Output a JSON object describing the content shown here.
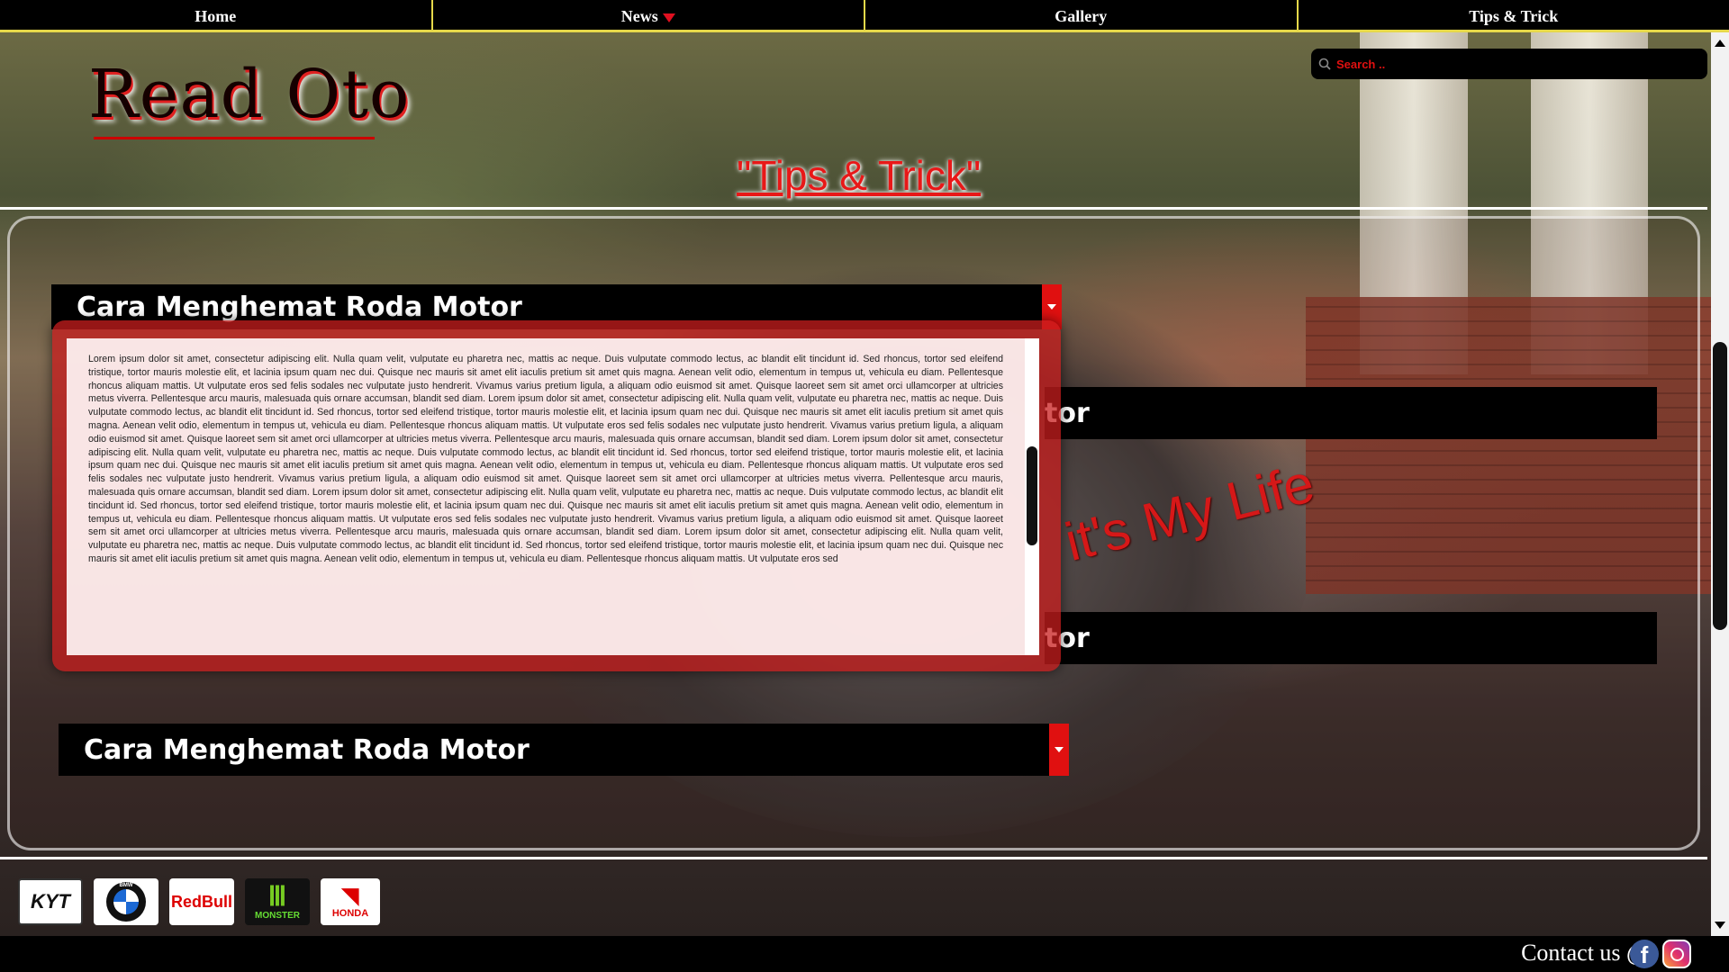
{
  "nav": {
    "items": [
      {
        "label": "Home"
      },
      {
        "label": "News"
      },
      {
        "label": "Gallery"
      },
      {
        "label": "Tips & Trick"
      }
    ]
  },
  "header": {
    "logo_text": "Read Oto",
    "page_heading": "\"Tips & Trick\"",
    "search_placeholder": "Search .."
  },
  "accordions": [
    {
      "title": "Cara Menghemat Roda Motor"
    },
    {
      "title": "tor"
    },
    {
      "title": "tor"
    },
    {
      "title": "Cara Menghemat Roda Motor"
    }
  ],
  "content": {
    "text": "Lorem ipsum dolor sit amet, consectetur adipiscing elit. Nulla quam velit, vulputate eu pharetra nec, mattis ac neque. Duis vulputate commodo lectus, ac blandit elit tincidunt id. Sed rhoncus, tortor sed eleifend tristique, tortor mauris molestie elit, et lacinia ipsum quam nec dui. Quisque nec mauris sit amet elit iaculis pretium sit amet quis magna. Aenean velit odio, elementum in tempus ut, vehicula eu diam. Pellentesque rhoncus aliquam mattis. Ut vulputate eros sed felis sodales nec vulputate justo hendrerit. Vivamus varius pretium ligula, a aliquam odio euismod sit amet. Quisque laoreet sem sit amet orci ullamcorper at ultricies metus viverra. Pellentesque arcu mauris, malesuada quis ornare accumsan, blandit sed diam. Lorem ipsum dolor sit amet, consectetur adipiscing elit. Nulla quam velit, vulputate eu pharetra nec, mattis ac neque. Duis vulputate commodo lectus, ac blandit elit tincidunt id. Sed rhoncus, tortor sed eleifend tristique, tortor mauris molestie elit, et lacinia ipsum quam nec dui. Quisque nec mauris sit amet elit iaculis pretium sit amet quis magna. Aenean velit odio, elementum in tempus ut, vehicula eu diam. Pellentesque rhoncus aliquam mattis. Ut vulputate eros sed felis sodales nec vulputate justo hendrerit. Vivamus varius pretium ligula, a aliquam odio euismod sit amet. Quisque laoreet sem sit amet orci ullamcorper at ultricies metus viverra. Pellentesque arcu mauris, malesuada quis ornare accumsan, blandit sed diam. Lorem ipsum dolor sit amet, consectetur adipiscing elit. Nulla quam velit, vulputate eu pharetra nec, mattis ac neque. Duis vulputate commodo lectus, ac blandit elit tincidunt id. Sed rhoncus, tortor sed eleifend tristique, tortor mauris molestie elit, et lacinia ipsum quam nec dui. Quisque nec mauris sit amet elit iaculis pretium sit amet quis magna. Aenean velit odio, elementum in tempus ut, vehicula eu diam. Pellentesque rhoncus aliquam mattis. Ut vulputate eros sed felis sodales nec vulputate justo hendrerit. Vivamus varius pretium ligula, a aliquam odio euismod sit amet. Quisque laoreet sem sit amet orci ullamcorper at ultricies metus viverra. Pellentesque arcu mauris, malesuada quis ornare accumsan, blandit sed diam. Lorem ipsum dolor sit amet, consectetur adipiscing elit. Nulla quam velit, vulputate eu pharetra nec, mattis ac neque. Duis vulputate commodo lectus, ac blandit elit tincidunt id. Sed rhoncus, tortor sed eleifend tristique, tortor mauris molestie elit, et lacinia ipsum quam nec dui. Quisque nec mauris sit amet elit iaculis pretium sit amet quis magna. Aenean velit odio, elementum in tempus ut, vehicula eu diam. Pellentesque rhoncus aliquam mattis. Ut vulputate eros sed felis sodales nec vulputate justo hendrerit. Vivamus varius pretium ligula, a aliquam odio euismod sit amet. Quisque laoreet sem sit amet orci ullamcorper at ultricies metus viverra. Pellentesque arcu mauris, malesuada quis ornare accumsan, blandit sed diam. Lorem ipsum dolor sit amet, consectetur adipiscing elit. Nulla quam velit, vulputate eu pharetra nec, mattis ac neque. Duis vulputate commodo lectus, ac blandit elit tincidunt id. Sed rhoncus, tortor sed eleifend tristique, tortor mauris molestie elit, et lacinia ipsum quam nec dui. Quisque nec mauris sit amet elit iaculis pretium sit amet quis magna. Aenean velit odio, elementum in tempus ut, vehicula eu diam. Pellentesque rhoncus aliquam mattis. Ut vulputate eros sed"
  },
  "slogan": "it's My Life",
  "brands": [
    {
      "name": "KYT",
      "icon": "kyt-logo"
    },
    {
      "name": "BMW",
      "icon": "bmw-logo"
    },
    {
      "name": "RedBull",
      "icon": "redbull-logo"
    },
    {
      "name": "MONSTER",
      "icon": "monster-logo"
    },
    {
      "name": "HONDA",
      "icon": "honda-logo"
    }
  ],
  "footer": {
    "contact_label": "Contact us @",
    "social": [
      "facebook-icon",
      "instagram-icon"
    ]
  },
  "colors": {
    "accent_red": "#e01010",
    "nav_border": "#e6d84a",
    "nav_bg": "#000000"
  }
}
